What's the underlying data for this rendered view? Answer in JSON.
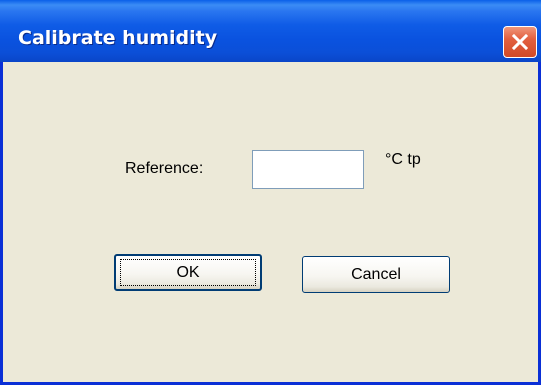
{
  "window": {
    "title": "Calibrate humidity"
  },
  "form": {
    "reference_label": "Reference:",
    "reference_value": "",
    "unit_label": "°C tp"
  },
  "buttons": {
    "ok_label": "OK",
    "cancel_label": "Cancel"
  },
  "icons": {
    "close": "close-icon"
  },
  "colors": {
    "titlebar": "#0a52df",
    "close_button": "#e26040",
    "dialog_background": "#ece9d8"
  }
}
